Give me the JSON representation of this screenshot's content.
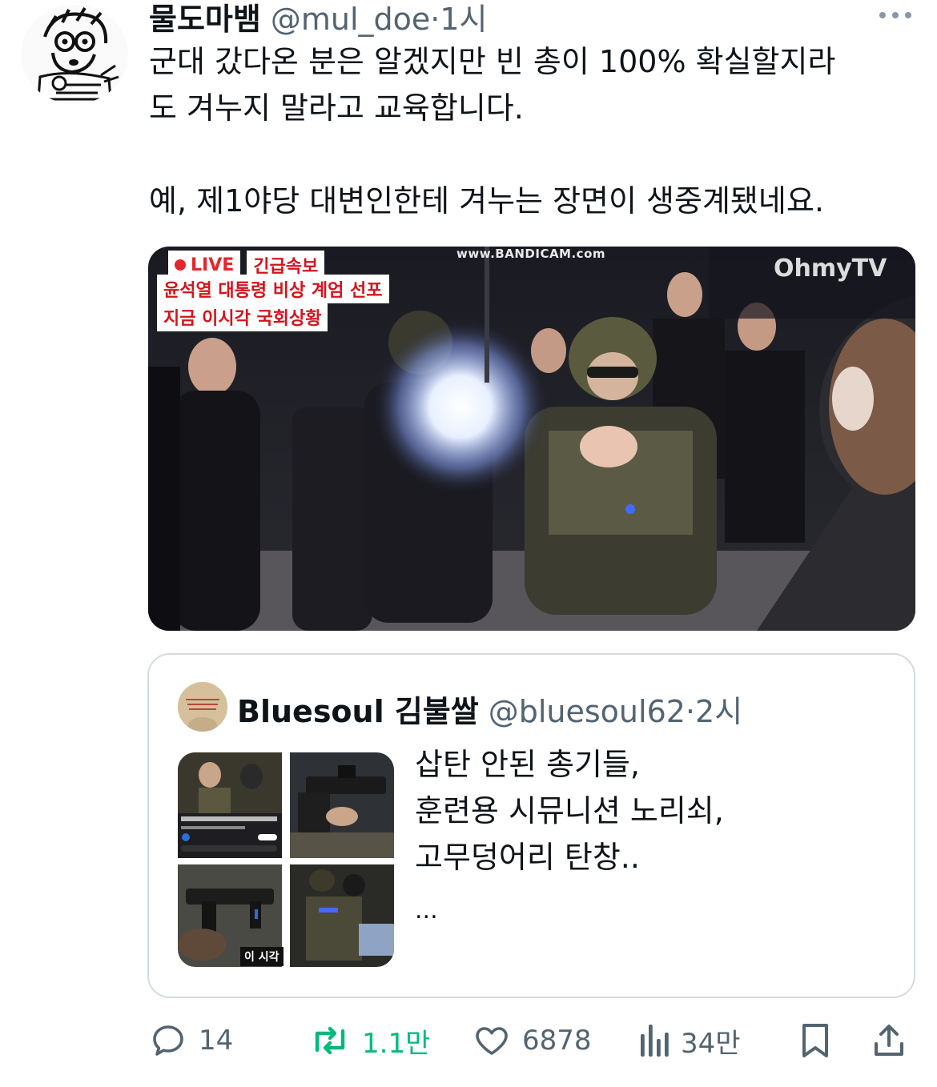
{
  "tweet": {
    "author_name": "물도마뱀",
    "handle": "@mul_doe",
    "time": "1시",
    "text": "군대 갔다온 분은 알겠지만 빈 총이 100% 확실할지라\n도 겨누지 말라고 교육합니다.\n\n예, 제1야당 대변인한테 겨누는 장면이 생중계됐네요.",
    "media": {
      "live_label": "LIVE",
      "breaking_label": "긴급속보",
      "headline_1": "윤석열 대통령 비상 계엄 선포",
      "headline_2": "지금 이시각 국회상황",
      "watermark": "www.BANDICAM.com",
      "channel_logo": "OhmyTV"
    }
  },
  "quoted_tweet": {
    "author_name": "Bluesoul 김불쌀",
    "handle": "@bluesoul62",
    "time": "2시",
    "text": "삽탄 안된 총기들,\n훈련용 시뮤니션 노리쇠,\n고무덩어리 탄창..",
    "ellipsis": "...",
    "thumb_tag": "이 시각"
  },
  "actions": {
    "replies": "14",
    "retweets": "1.1만",
    "likes": "6878",
    "views": "34만"
  },
  "colors": {
    "retweet_green": "#00ba7c",
    "muted_gray": "#536471",
    "live_red": "#e5262b"
  }
}
